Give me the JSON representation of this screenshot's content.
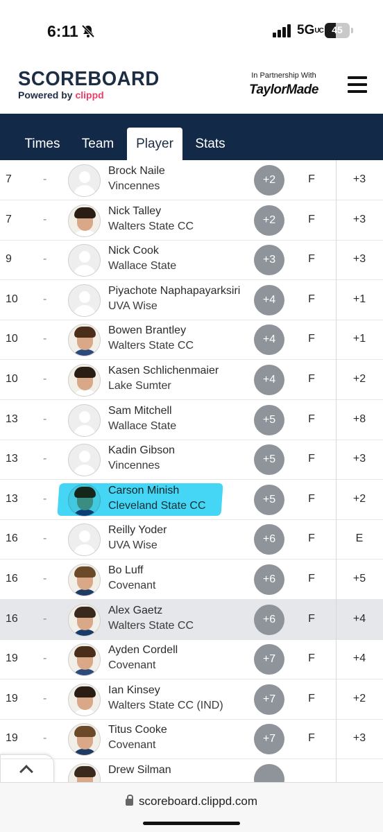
{
  "status_bar": {
    "time": "6:11",
    "network": "5G",
    "network_suffix": "UC",
    "battery": "45",
    "battery_level": 0.45
  },
  "header": {
    "brand_title": "SCOREBOARD",
    "brand_powered": "Powered by ",
    "brand_clippd": "clippd",
    "partner_label": "In Partnership With",
    "partner_name": "TaylorMade"
  },
  "nav": {
    "tabs": [
      {
        "label": "Times",
        "active": false
      },
      {
        "label": "Team",
        "active": false
      },
      {
        "label": "Player",
        "active": true
      },
      {
        "label": "Stats",
        "active": false
      }
    ]
  },
  "rows": [
    {
      "pos": "7",
      "move": "-",
      "name": "Brock Naile",
      "team": "Vincennes",
      "score": "+2",
      "thru": "F",
      "total": "+3",
      "photo": false
    },
    {
      "pos": "7",
      "move": "-",
      "name": "Nick Talley",
      "team": "Walters State CC",
      "score": "+2",
      "thru": "F",
      "total": "+3",
      "photo": true
    },
    {
      "pos": "9",
      "move": "-",
      "name": "Nick Cook",
      "team": "Wallace State",
      "score": "+3",
      "thru": "F",
      "total": "+3",
      "photo": false
    },
    {
      "pos": "10",
      "move": "-",
      "name": "Piyachote Naphapayarksiri",
      "team": "UVA Wise",
      "score": "+4",
      "thru": "F",
      "total": "+1",
      "photo": false
    },
    {
      "pos": "10",
      "move": "-",
      "name": "Bowen Brantley",
      "team": "Walters State CC",
      "score": "+4",
      "thru": "F",
      "total": "+1",
      "photo": true
    },
    {
      "pos": "10",
      "move": "-",
      "name": "Kasen Schlichenmaier",
      "team": "Lake Sumter",
      "score": "+4",
      "thru": "F",
      "total": "+2",
      "photo": true
    },
    {
      "pos": "13",
      "move": "-",
      "name": "Sam Mitchell",
      "team": "Wallace State",
      "score": "+5",
      "thru": "F",
      "total": "+8",
      "photo": false
    },
    {
      "pos": "13",
      "move": "-",
      "name": "Kadin Gibson",
      "team": "Vincennes",
      "score": "+5",
      "thru": "F",
      "total": "+3",
      "photo": false
    },
    {
      "pos": "13",
      "move": "-",
      "name": "Carson Minish",
      "team": "Cleveland State CC",
      "score": "+5",
      "thru": "F",
      "total": "+2",
      "photo": true
    },
    {
      "pos": "16",
      "move": "-",
      "name": "Reilly Yoder",
      "team": "UVA Wise",
      "score": "+6",
      "thru": "F",
      "total": "E",
      "photo": false
    },
    {
      "pos": "16",
      "move": "-",
      "name": "Bo Luff",
      "team": "Covenant",
      "score": "+6",
      "thru": "F",
      "total": "+5",
      "photo": true
    },
    {
      "pos": "16",
      "move": "-",
      "name": "Alex Gaetz",
      "team": "Walters State CC",
      "score": "+6",
      "thru": "F",
      "total": "+4",
      "photo": true,
      "shaded": true
    },
    {
      "pos": "19",
      "move": "-",
      "name": "Ayden Cordell",
      "team": "Covenant",
      "score": "+7",
      "thru": "F",
      "total": "+4",
      "photo": true
    },
    {
      "pos": "19",
      "move": "-",
      "name": "Ian Kinsey",
      "team": "Walters State CC (IND)",
      "score": "+7",
      "thru": "F",
      "total": "+2",
      "photo": true
    },
    {
      "pos": "19",
      "move": "-",
      "name": "Titus Cooke",
      "team": "Covenant",
      "score": "+7",
      "thru": "F",
      "total": "+3",
      "photo": true
    },
    {
      "pos": "",
      "move": "",
      "name": "Drew Silman",
      "team": "",
      "score": "",
      "thru": "",
      "total": "",
      "photo": true
    }
  ],
  "browser": {
    "url": "scoreboard.clippd.com"
  }
}
